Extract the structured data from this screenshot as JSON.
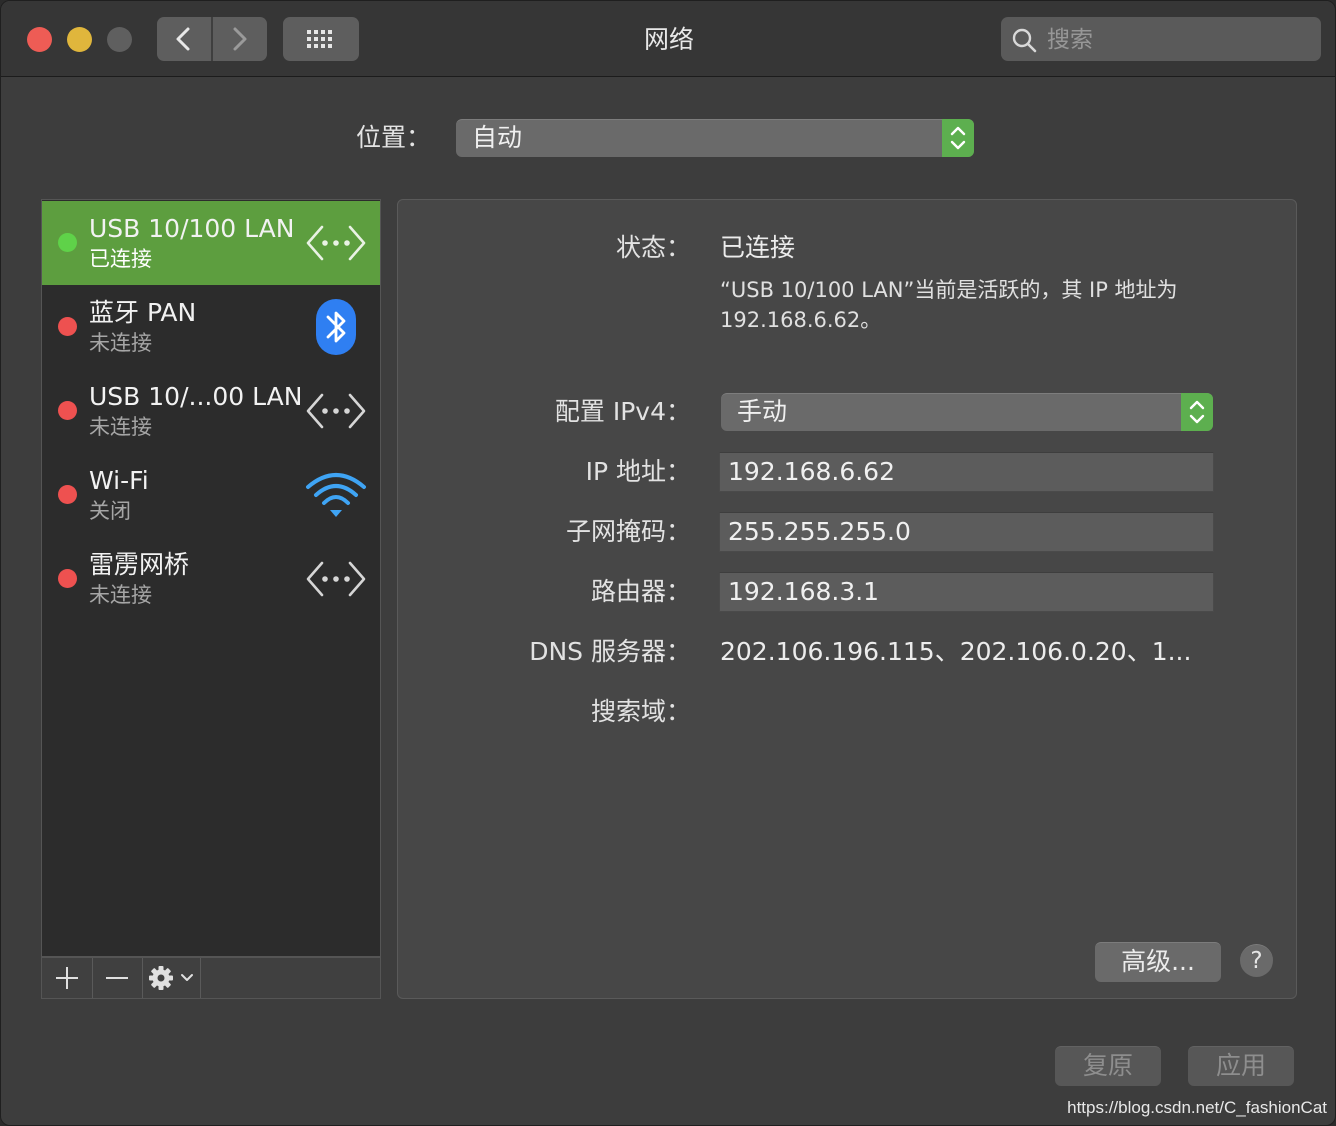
{
  "window": {
    "title": "网络"
  },
  "search": {
    "placeholder": "搜索"
  },
  "location": {
    "label": "位置：",
    "value": "自动"
  },
  "services": [
    {
      "name": "USB 10/100 LAN",
      "status": "已连接",
      "state": "connected",
      "icon": "ethernet-icon",
      "selected": true
    },
    {
      "name": "蓝牙 PAN",
      "status": "未连接",
      "state": "disconnected",
      "icon": "bluetooth-icon",
      "selected": false
    },
    {
      "name": "USB 10/...00 LAN",
      "status": "未连接",
      "state": "disconnected",
      "icon": "ethernet-icon",
      "selected": false
    },
    {
      "name": "Wi-Fi",
      "status": "关闭",
      "state": "off",
      "icon": "wifi-icon",
      "selected": false
    },
    {
      "name": "雷雳网桥",
      "status": "未连接",
      "state": "disconnected",
      "icon": "ethernet-icon",
      "selected": false
    }
  ],
  "details": {
    "status_label": "状态：",
    "status_value": "已连接",
    "status_description": "“USB 10/100 LAN”当前是活跃的，其 IP 地址为 192.168.6.62。",
    "ipv4_config_label": "配置 IPv4：",
    "ipv4_config_value": "手动",
    "ip_label": "IP 地址：",
    "ip_value": "192.168.6.62",
    "subnet_label": "子网掩码：",
    "subnet_value": "255.255.255.0",
    "router_label": "路由器：",
    "router_value": "192.168.3.1",
    "dns_label": "DNS 服务器：",
    "dns_value": "202.106.196.115、202.106.0.20、1...",
    "search_domain_label": "搜索域："
  },
  "buttons": {
    "advanced": "高级...",
    "help": "?",
    "revert": "复原",
    "apply": "应用"
  },
  "watermark": "https://blog.csdn.net/C_fashionCat",
  "colors": {
    "accent_green": "#5d9e3f",
    "connected": "#5fd249",
    "disconnected": "#ee5150",
    "bluetooth": "#2f7ff2",
    "wifi": "#3fa4f4"
  }
}
